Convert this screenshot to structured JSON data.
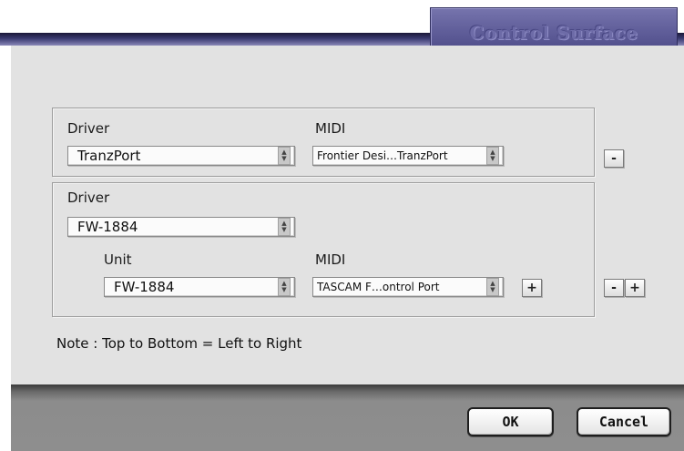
{
  "window": {
    "title": "Control Surface"
  },
  "group1": {
    "driver_label": "Driver",
    "driver_value": "TranzPort",
    "midi_label": "MIDI",
    "midi_value": "Frontier Desi…TranzPort",
    "remove_label": "-"
  },
  "group2": {
    "driver_label": "Driver",
    "driver_value": "FW-1884",
    "unit_label": "Unit",
    "unit_value": "FW-1884",
    "midi_label": "MIDI",
    "midi_value": "TASCAM F…ontrol Port",
    "add_midi_label": "+",
    "remove_label": "-",
    "add_label": "+"
  },
  "note": "Note : Top to Bottom = Left to Right",
  "buttons": {
    "ok": "OK",
    "cancel": "Cancel"
  }
}
